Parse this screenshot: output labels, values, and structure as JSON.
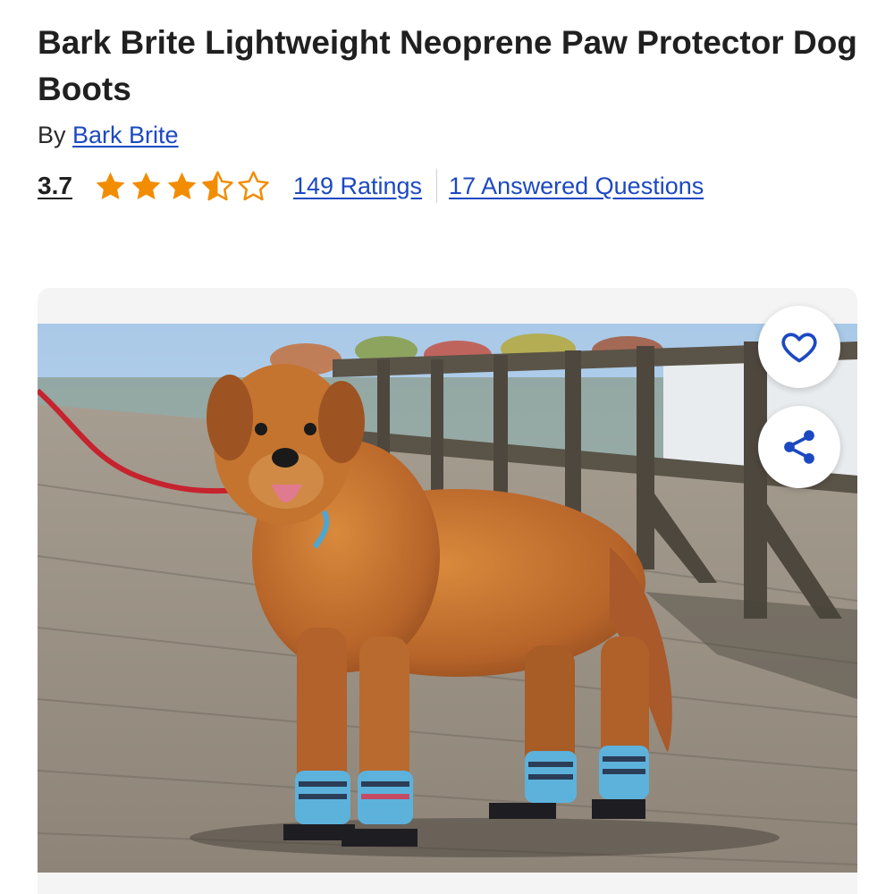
{
  "product": {
    "title": "Bark Brite Lightweight Neoprene Paw Protector Dog Boots",
    "by_prefix": "By",
    "brand": "Bark Brite"
  },
  "rating": {
    "value": "3.7",
    "stars_filled": 3.5,
    "stars_total": 5,
    "star_color": "#f28c00",
    "ratings_link": "149 Ratings",
    "questions_link": "17 Answered Questions"
  },
  "gallery": {
    "image_subject": "golden retriever wearing blue striped dog boots on a wooden boardwalk",
    "favorite_icon": "heart-icon",
    "share_icon": "share-icon"
  },
  "colors": {
    "link": "#1c49c2",
    "icon": "#1c49c2"
  }
}
